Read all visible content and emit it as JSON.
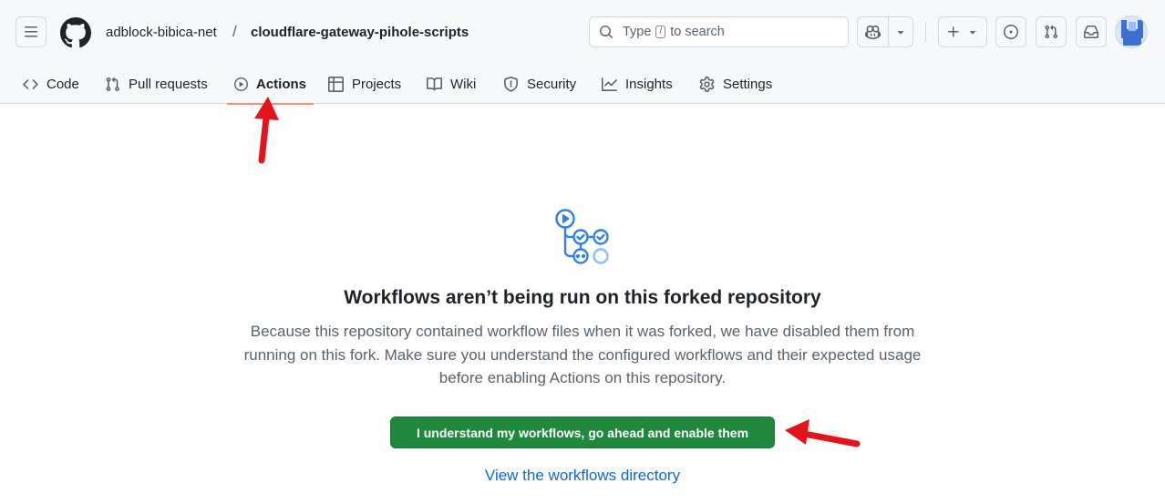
{
  "header": {
    "owner": "adblock-bibica-net",
    "separator": "/",
    "repo": "cloudflare-gateway-pihole-scripts",
    "search": {
      "prefix": "Type",
      "key": "/",
      "suffix": "to search"
    }
  },
  "tabs": [
    {
      "label": "Code",
      "icon": "code-icon",
      "active": false
    },
    {
      "label": "Pull requests",
      "icon": "git-pull-request-icon",
      "active": false
    },
    {
      "label": "Actions",
      "icon": "play-icon",
      "active": true
    },
    {
      "label": "Projects",
      "icon": "table-icon",
      "active": false
    },
    {
      "label": "Wiki",
      "icon": "book-icon",
      "active": false
    },
    {
      "label": "Security",
      "icon": "shield-icon",
      "active": false
    },
    {
      "label": "Insights",
      "icon": "graph-icon",
      "active": false
    },
    {
      "label": "Settings",
      "icon": "gear-icon",
      "active": false
    }
  ],
  "main": {
    "heading": "Workflows aren’t being run on this forked repository",
    "description": "Because this repository contained workflow files when it was forked, we have disabled them from running on this fork. Make sure you understand the configured workflows and their expected usage before enabling Actions on this repository.",
    "enable_button": "I understand my workflows, go ahead and enable them",
    "directory_link": "View the workflows directory"
  },
  "colors": {
    "accent_tab": "#fd8c73",
    "primary_button": "#1f883d",
    "link": "#0969da",
    "annotation_arrow": "#e3141b",
    "workflow_icon": "#2f80ed"
  }
}
